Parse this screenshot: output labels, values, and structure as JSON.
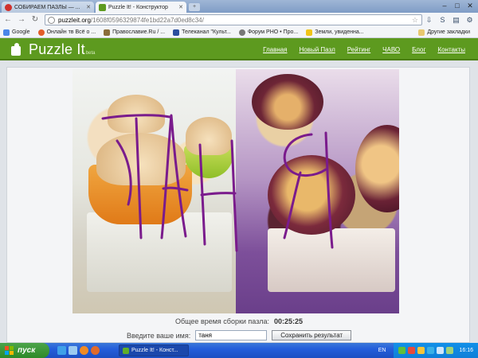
{
  "browser": {
    "tabs": [
      {
        "label": "СОБИРАЕМ ПАЗЛЫ — ...",
        "active": false
      },
      {
        "label": "Puzzle It! - Конструктор",
        "active": true
      }
    ],
    "url": {
      "host": "puzzleit.org",
      "path": "/1608f0596329874fe1bd22a7d0ed8c34/"
    },
    "bookmarks": [
      {
        "label": "Google",
        "icon": "google-icon"
      },
      {
        "label": "Онлайн тв Всё о ...",
        "icon": "tv-icon"
      },
      {
        "label": "Православие.Ru / ...",
        "icon": "cross-icon"
      },
      {
        "label": "Телеканал \"Культ...",
        "icon": "channel-icon"
      },
      {
        "label": "Форум РНО • Про...",
        "icon": "forum-icon"
      },
      {
        "label": "Земли, увиденна...",
        "icon": "star-icon"
      }
    ],
    "other_bookmarks": "Другие закладки"
  },
  "site": {
    "logo": "Puzzle It",
    "beta": "beta",
    "nav": [
      "Главная",
      "Новый Пазл",
      "Рейтинг",
      "ЧАВО",
      "Блог",
      "Контакты"
    ]
  },
  "puzzle": {
    "scribble_text": "ТАНЯ",
    "time_label": "Общее время сборки пазла:",
    "time_value": "00:25:25",
    "name_label": "Введите ваше имя:",
    "name_value": "таня",
    "save_button": "Сохранить результат"
  },
  "taskbar": {
    "start": "пуск",
    "window": "Puzzle It! - Конст...",
    "lang": "EN",
    "clock": "16:16"
  },
  "colors": {
    "brand_green": "#5d9a1f",
    "scribble": "#7a1b8c",
    "taskbar_blue": "#245edb"
  }
}
